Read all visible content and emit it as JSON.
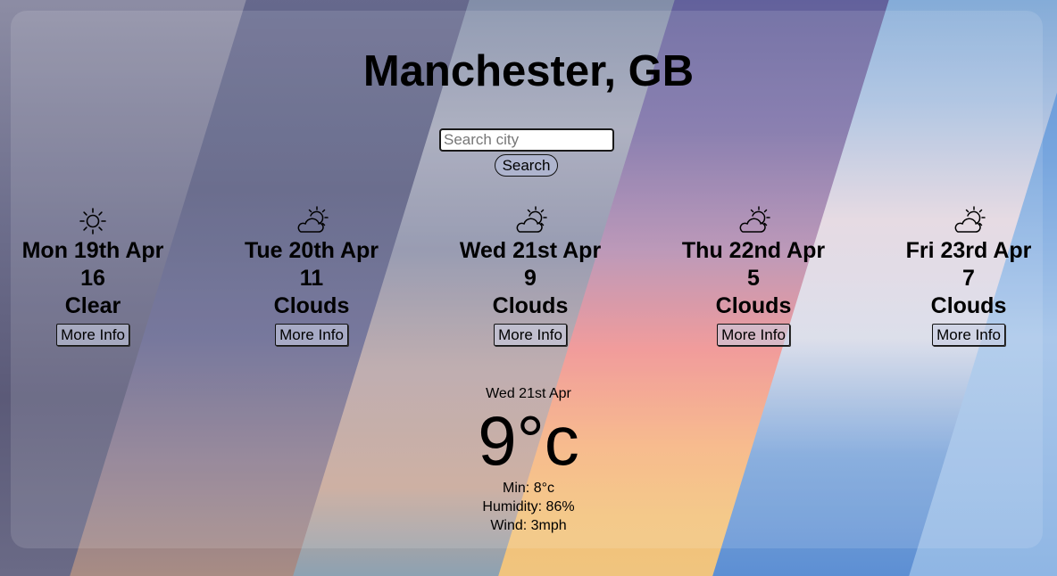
{
  "city_title": "Manchester, GB",
  "search": {
    "placeholder": "Search city",
    "button_label": "Search"
  },
  "forecast": [
    {
      "date": "Mon 19th Apr",
      "temp": "16",
      "condition": "Clear",
      "icon": "sun-icon",
      "button": "More Info"
    },
    {
      "date": "Tue 20th Apr",
      "temp": "11",
      "condition": "Clouds",
      "icon": "partly-cloudy-icon",
      "button": "More Info"
    },
    {
      "date": "Wed 21st Apr",
      "temp": "9",
      "condition": "Clouds",
      "icon": "partly-cloudy-icon",
      "button": "More Info"
    },
    {
      "date": "Thu 22nd Apr",
      "temp": "5",
      "condition": "Clouds",
      "icon": "partly-cloudy-icon",
      "button": "More Info"
    },
    {
      "date": "Fri 23rd Apr",
      "temp": "7",
      "condition": "Clouds",
      "icon": "partly-cloudy-icon",
      "button": "More Info"
    }
  ],
  "detail": {
    "date": "Wed 21st Apr",
    "temp": "9°c",
    "min": "Min: 8°c",
    "humidity": "Humidity: 86%",
    "wind": "Wind: 3mph"
  }
}
